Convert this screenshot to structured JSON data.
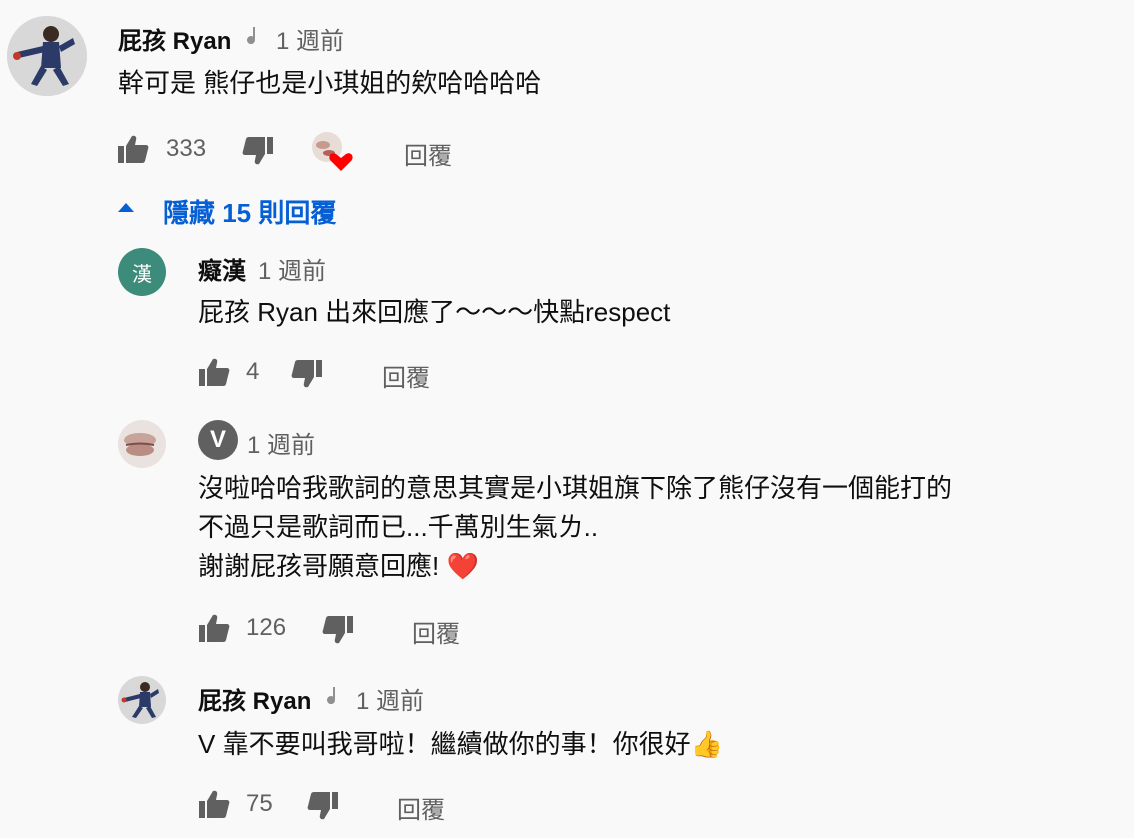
{
  "top_comment": {
    "author": "屁孩 Ryan",
    "time": "1 週前",
    "text": "幹可是 熊仔也是小琪姐的欸哈哈哈哈",
    "likes": "333",
    "reply_label": "回覆"
  },
  "replies_toggle": {
    "label": "隱藏 15 則回覆"
  },
  "replies": [
    {
      "author": "癡漢",
      "avatar_letter": "漢",
      "avatar_color": "#3d8b7a",
      "time": "1 週前",
      "text": "屁孩 Ryan 出來回應了～～～快點respect",
      "likes": "4",
      "reply_label": "回覆"
    },
    {
      "author_badge": "V",
      "time": "1 週前",
      "lines": [
        "沒啦哈哈我歌詞的意思其實是小琪姐旗下除了熊仔沒有一個能打的",
        "不過只是歌詞而已...千萬別生氣ㄌ..",
        "謝謝屁孩哥願意回應! ❤️"
      ],
      "likes": "126",
      "reply_label": "回覆"
    },
    {
      "author": "屁孩 Ryan",
      "time": "1 週前",
      "text": "V 靠不要叫我哥啦！繼續做你的事！你很好👍",
      "likes": "75",
      "reply_label": "回覆"
    }
  ]
}
